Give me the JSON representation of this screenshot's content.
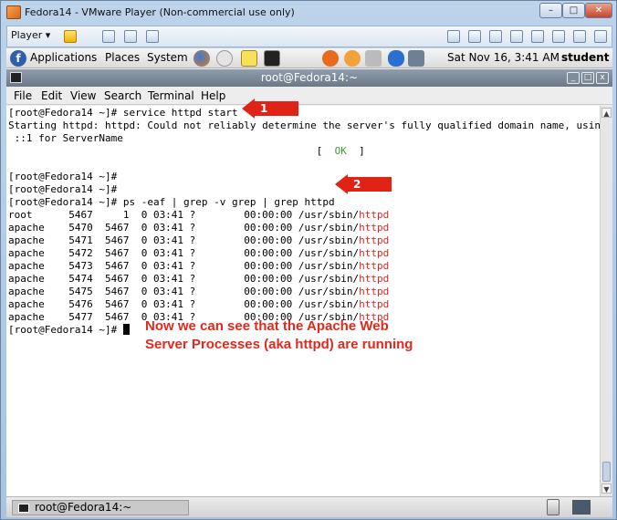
{
  "window": {
    "title": "Fedora14 - VMware Player (Non-commercial use only)",
    "minimize": "–",
    "maximize": "□",
    "close": "✕"
  },
  "toolbar": {
    "player_label": "Player ▾"
  },
  "panel": {
    "menus": [
      "Applications",
      "Places",
      "System"
    ],
    "clock": "Sat Nov 16,  3:41 AM",
    "user": "student"
  },
  "terminal": {
    "title": "root@Fedora14:~",
    "menus": [
      "File",
      "Edit",
      "View",
      "Search",
      "Terminal",
      "Help"
    ],
    "lines": [
      "[root@Fedora14 ~]# service httpd start",
      "Starting httpd: httpd: Could not reliably determine the server's fully qualified domain name, using",
      " ::1 for ServerName",
      "",
      "",
      "[root@Fedora14 ~]#",
      "[root@Fedora14 ~]#",
      "[root@Fedora14 ~]# ps -eaf | grep -v grep | grep httpd"
    ],
    "ok_prefix": "                                                   [  ",
    "ok_text": "OK",
    "ok_suffix": "  ]",
    "processes": [
      {
        "prefix": "root      5467     1  0 03:41 ?        00:00:00 /usr/sbin/",
        "name": "httpd"
      },
      {
        "prefix": "apache    5470  5467  0 03:41 ?        00:00:00 /usr/sbin/",
        "name": "httpd"
      },
      {
        "prefix": "apache    5471  5467  0 03:41 ?        00:00:00 /usr/sbin/",
        "name": "httpd"
      },
      {
        "prefix": "apache    5472  5467  0 03:41 ?        00:00:00 /usr/sbin/",
        "name": "httpd"
      },
      {
        "prefix": "apache    5473  5467  0 03:41 ?        00:00:00 /usr/sbin/",
        "name": "httpd"
      },
      {
        "prefix": "apache    5474  5467  0 03:41 ?        00:00:00 /usr/sbin/",
        "name": "httpd"
      },
      {
        "prefix": "apache    5475  5467  0 03:41 ?        00:00:00 /usr/sbin/",
        "name": "httpd"
      },
      {
        "prefix": "apache    5476  5467  0 03:41 ?        00:00:00 /usr/sbin/",
        "name": "httpd"
      },
      {
        "prefix": "apache    5477  5467  0 03:41 ?        00:00:00 /usr/sbin/",
        "name": "httpd"
      }
    ],
    "prompt": "[root@Fedora14 ~]# "
  },
  "taskbar": {
    "task_label": "root@Fedora14:~"
  },
  "annotations": {
    "arrow1_number": "1",
    "arrow2_number": "2",
    "note": "Now we can see that the Apache Web Server Processes (aka httpd) are running",
    "color": "#e02316"
  },
  "icons": [
    "fedora-logo-icon",
    "firefox-icon",
    "notes-icon",
    "terminal-icon",
    "trash-icon",
    "scroll-up-icon",
    "scroll-down-icon"
  ]
}
